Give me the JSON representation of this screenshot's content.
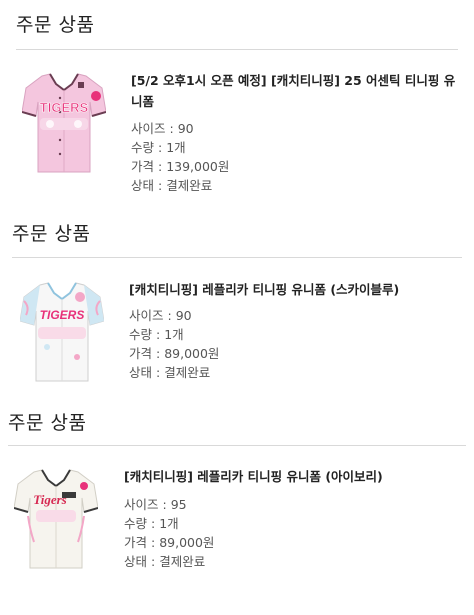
{
  "order_items": [
    {
      "section_title": "주문 상품",
      "product_name": "[5/2 오후1시 오픈 예정] [캐치티니핑] 25 어센틱 티니핑 유니폼",
      "thumbnail_icon": "pink-tigers-jersey",
      "jersey_color": "#f4c6de",
      "details": [
        {
          "label": "사이즈",
          "value": "90"
        },
        {
          "label": "수량",
          "value": "1개"
        },
        {
          "label": "가격",
          "value": "139,000원"
        },
        {
          "label": "상태",
          "value": "결제완료"
        }
      ]
    },
    {
      "section_title": "주문 상품",
      "product_name": "[캐치티니핑] 레플리카 티니핑 유니폼 (스카이블루)",
      "thumbnail_icon": "skyblue-tigers-jersey",
      "jersey_color": "#cfe7f3",
      "details": [
        {
          "label": "사이즈",
          "value": "90"
        },
        {
          "label": "수량",
          "value": "1개"
        },
        {
          "label": "가격",
          "value": "89,000원"
        },
        {
          "label": "상태",
          "value": "결제완료"
        }
      ]
    },
    {
      "section_title": "주문 상품",
      "product_name": "[캐치티니핑] 레플리카 티니핑 유니폼 (아이보리)",
      "thumbnail_icon": "ivory-tigers-jersey",
      "jersey_color": "#f6f4ee",
      "details": [
        {
          "label": "사이즈",
          "value": "95"
        },
        {
          "label": "수량",
          "value": "1개"
        },
        {
          "label": "가격",
          "value": "89,000원"
        },
        {
          "label": "상태",
          "value": "결제완료"
        }
      ]
    }
  ]
}
